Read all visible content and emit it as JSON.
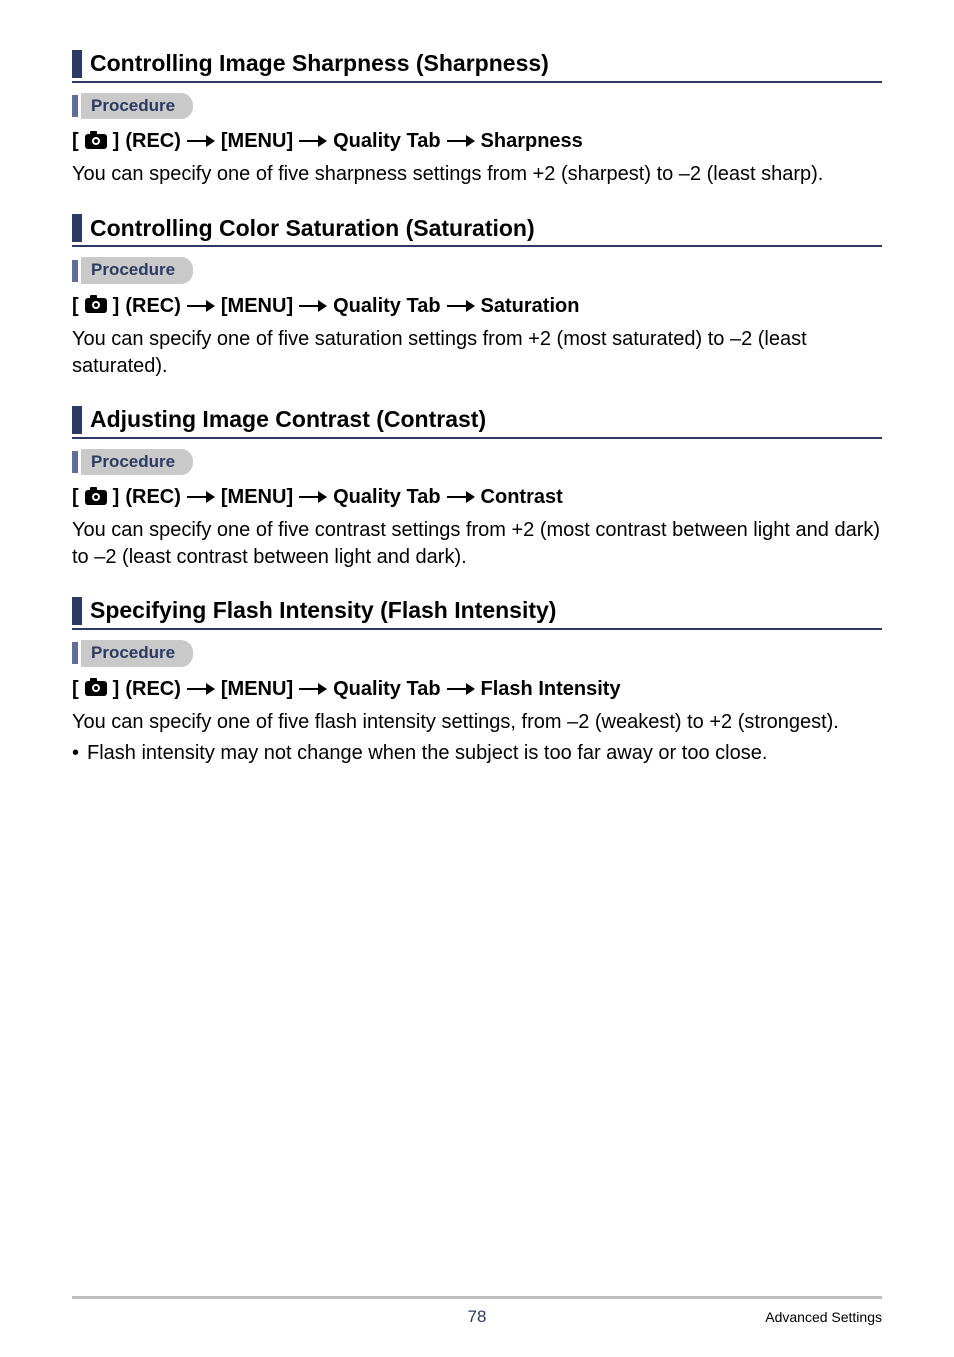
{
  "sections": [
    {
      "heading": "Controlling Image Sharpness (Sharpness)",
      "procedure_label": "Procedure",
      "path": {
        "rec": "(REC)",
        "menu": "[MENU]",
        "tab": "Quality Tab",
        "target": "Sharpness"
      },
      "body": "You can specify one of five sharpness settings from +2 (sharpest) to –2 (least sharp)."
    },
    {
      "heading": "Controlling Color Saturation (Saturation)",
      "procedure_label": "Procedure",
      "path": {
        "rec": "(REC)",
        "menu": "[MENU]",
        "tab": "Quality Tab",
        "target": "Saturation"
      },
      "body": "You can specify one of five saturation settings from +2 (most saturated) to –2 (least saturated)."
    },
    {
      "heading": "Adjusting Image Contrast (Contrast)",
      "procedure_label": "Procedure",
      "path": {
        "rec": "(REC)",
        "menu": "[MENU]",
        "tab": "Quality Tab",
        "target": "Contrast"
      },
      "body": "You can specify one of five contrast settings from +2 (most contrast between light and dark) to –2 (least contrast between light and dark)."
    },
    {
      "heading": "Specifying Flash Intensity (Flash Intensity)",
      "procedure_label": "Procedure",
      "path": {
        "rec": "(REC)",
        "menu": "[MENU]",
        "tab": "Quality Tab",
        "target": "Flash Intensity"
      },
      "body": "You can specify one of five flash intensity settings, from –2 (weakest) to +2 (strongest).",
      "bullet": "Flash intensity may not change when the subject is too far away or too close."
    }
  ],
  "footer": {
    "page_number": "78",
    "chapter": "Advanced Settings"
  }
}
